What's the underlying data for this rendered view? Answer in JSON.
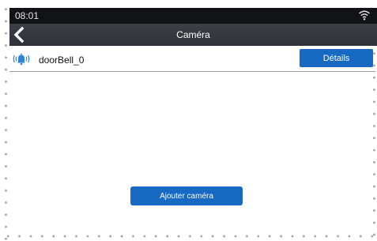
{
  "status_bar": {
    "time": "08:01",
    "wifi_icon": "wifi-icon"
  },
  "nav": {
    "title": "Caméra",
    "back_icon": "chevron-left-icon"
  },
  "devices": [
    {
      "name": "doorBell_0",
      "icon": "doorbell-icon",
      "action_label": "Détails"
    }
  ],
  "add_camera_label": "Ajouter caméra",
  "colors": {
    "accent": "#1769c4",
    "status_bar": "#111317",
    "nav_bar": "#33373d",
    "bell_icon": "#2f86d8"
  }
}
